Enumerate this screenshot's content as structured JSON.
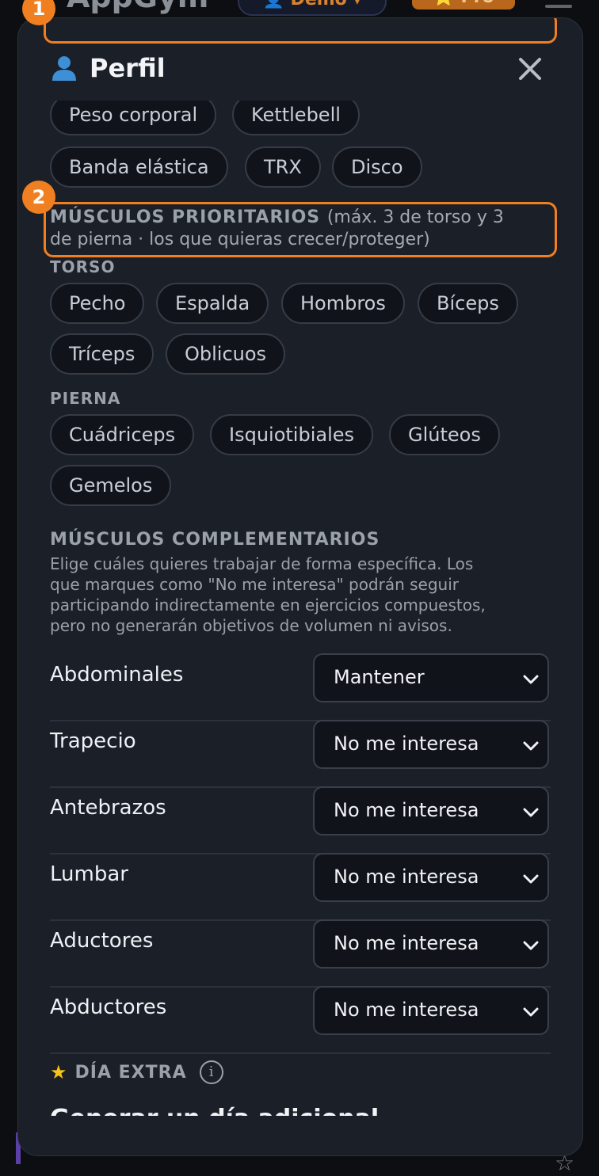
{
  "background": {
    "app_name": "AppGym",
    "demo_label": "👤 Demo ▾",
    "pro_label": "⭐ Pro"
  },
  "annotations": [
    "1",
    "2"
  ],
  "modal": {
    "title": "Perfil",
    "equipment_chips": [
      "Peso corporal",
      "Kettlebell",
      "Banda elástica",
      "TRX",
      "Disco"
    ],
    "priority": {
      "heading": "MÚSCULOS PRIORITARIOS",
      "note_line1": "(máx. 3 de torso y 3",
      "note_line2": "de pierna · los que quieras crecer/proteger)",
      "torso_label": "TORSO",
      "torso_chips": [
        "Pecho",
        "Espalda",
        "Hombros",
        "Bíceps",
        "Tríceps",
        "Oblicuos"
      ],
      "leg_label": "PIERNA",
      "leg_chips": [
        "Cuádriceps",
        "Isquiotibiales",
        "Glúteos",
        "Gemelos"
      ]
    },
    "complementary": {
      "heading": "MÚSCULOS COMPLEMENTARIOS",
      "desc_lines": [
        "Elige cuáles quieres trabajar de forma específica. Los",
        "que marques como \"No me interesa\" podrán seguir",
        "participando indirectamente en ejercicios compuestos,",
        "pero no generarán objetivos de volumen ni avisos."
      ],
      "rows": [
        {
          "label": "Abdominales",
          "value": "Mantener"
        },
        {
          "label": "Trapecio",
          "value": "No me interesa"
        },
        {
          "label": "Antebrazos",
          "value": "No me interesa"
        },
        {
          "label": "Lumbar",
          "value": "No me interesa"
        },
        {
          "label": "Aductores",
          "value": "No me interesa"
        },
        {
          "label": "Abductores",
          "value": "No me interesa"
        }
      ]
    },
    "extra": {
      "heading": "DÍA EXTRA",
      "info": "i",
      "subtitle": "Generar un día adicional"
    }
  },
  "colors": {
    "accent": "#f07f22",
    "panel": "#1b1f27",
    "chip_bg": "#10131a"
  }
}
